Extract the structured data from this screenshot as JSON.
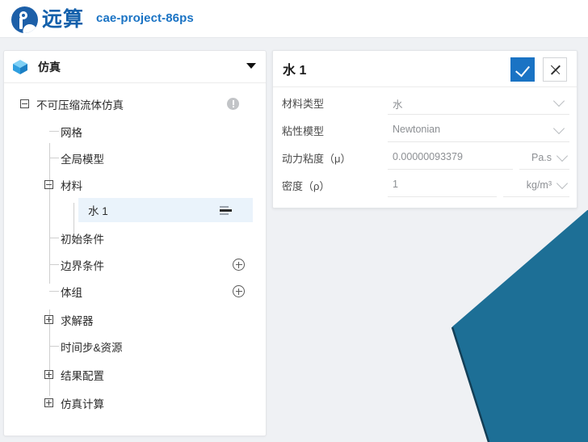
{
  "topbar": {
    "logo_text": "远算",
    "logo_icon": "yuansuan-logo-icon",
    "project_name": "cae-project-86ps"
  },
  "tree_panel": {
    "header": {
      "icon": "cube-icon",
      "title": "仿真",
      "collapse_icon": "caret-down-icon"
    },
    "items": [
      {
        "label": "不可压缩流体仿真",
        "indent": 0,
        "toggle": "minus",
        "badge": "warning-icon",
        "selected": false
      },
      {
        "label": "网格",
        "indent": 1,
        "toggle": "none",
        "badge": "none",
        "selected": false
      },
      {
        "label": "全局模型",
        "indent": 1,
        "toggle": "none",
        "badge": "none",
        "selected": false
      },
      {
        "label": "材料",
        "indent": 0,
        "toggle": "minus",
        "badge": "none",
        "selected": false
      },
      {
        "label": "水 1",
        "indent": 2,
        "toggle": "none",
        "badge": "list-icon",
        "selected": true
      },
      {
        "label": "初始条件",
        "indent": 1,
        "toggle": "none",
        "badge": "none",
        "selected": false
      },
      {
        "label": "边界条件",
        "indent": 1,
        "toggle": "none",
        "badge": "plus-icon",
        "selected": false
      },
      {
        "label": "体组",
        "indent": 1,
        "toggle": "none",
        "badge": "plus-icon",
        "selected": false
      },
      {
        "label": "求解器",
        "indent": 0,
        "toggle": "plus",
        "badge": "none",
        "selected": false
      },
      {
        "label": "时间步&资源",
        "indent": 1,
        "toggle": "none",
        "badge": "none",
        "selected": false
      },
      {
        "label": "结果配置",
        "indent": 0,
        "toggle": "plus",
        "badge": "none",
        "selected": false
      },
      {
        "label": "仿真计算",
        "indent": 0,
        "toggle": "plus",
        "badge": "none",
        "selected": false
      }
    ]
  },
  "prop_panel": {
    "title": "水 1",
    "confirm_icon": "check-icon",
    "cancel_icon": "close-icon",
    "fields": [
      {
        "label": "材料类型",
        "value": "水",
        "unit": "",
        "type": "select"
      },
      {
        "label": "粘性模型",
        "value": "Newtonian",
        "unit": "",
        "type": "select"
      },
      {
        "label": "动力粘度（μ）",
        "value": "0.00000093379",
        "unit": "Pa.s",
        "type": "number-with-unit"
      },
      {
        "label": "密度（ρ）",
        "value": "1",
        "unit": "kg/m³",
        "type": "number-with-unit"
      }
    ]
  },
  "viewport": {
    "geometry_name": "fluid-domain-face",
    "face_color": "#1d6f96",
    "edge_color": "#0f3f57",
    "background_color": "#eff1f4"
  },
  "colors": {
    "accent": "#1a73c4",
    "brand": "#1360ab",
    "selection": "#eaf3fb",
    "panel_bg": "#ffffff",
    "app_bg": "#eff1f4"
  }
}
